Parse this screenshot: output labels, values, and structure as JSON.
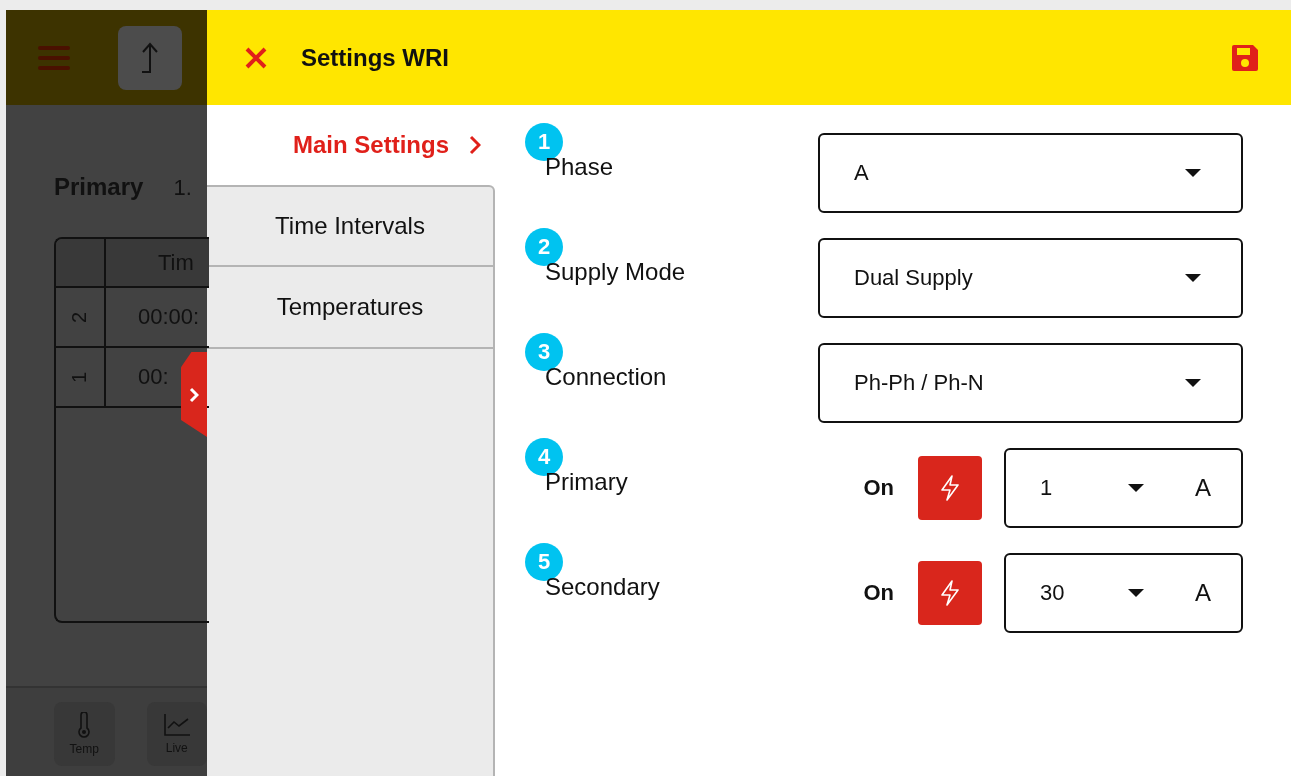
{
  "background_app": {
    "primary_label": "Primary",
    "primary_value": "1.",
    "table": {
      "column_header": "Tim",
      "rows": [
        {
          "index": "2",
          "time": "00:00:"
        },
        {
          "index": "1",
          "time": "00:"
        }
      ]
    },
    "bottom_bar": [
      {
        "kind": "temp",
        "label": "Temp"
      },
      {
        "kind": "live",
        "label": "Live"
      }
    ]
  },
  "panel": {
    "title": "Settings WRI",
    "nav": [
      {
        "label": "Main Settings",
        "selected": true
      },
      {
        "label": "Time Intervals",
        "selected": false
      },
      {
        "label": "Temperatures",
        "selected": false
      }
    ],
    "settings": [
      {
        "kind": "select",
        "number": "1",
        "label": "Phase",
        "value": "A"
      },
      {
        "kind": "select",
        "number": "2",
        "label": "Supply Mode",
        "value": "Dual Supply"
      },
      {
        "kind": "select",
        "number": "3",
        "label": "Connection",
        "value": "Ph-Ph / Ph-N"
      },
      {
        "kind": "switch_select",
        "number": "4",
        "label": "Primary",
        "status": "On",
        "on": true,
        "value": "1",
        "unit": "A"
      },
      {
        "kind": "switch_select",
        "number": "5",
        "label": "Secondary",
        "status": "On",
        "on": true,
        "value": "30",
        "unit": "A"
      }
    ]
  }
}
